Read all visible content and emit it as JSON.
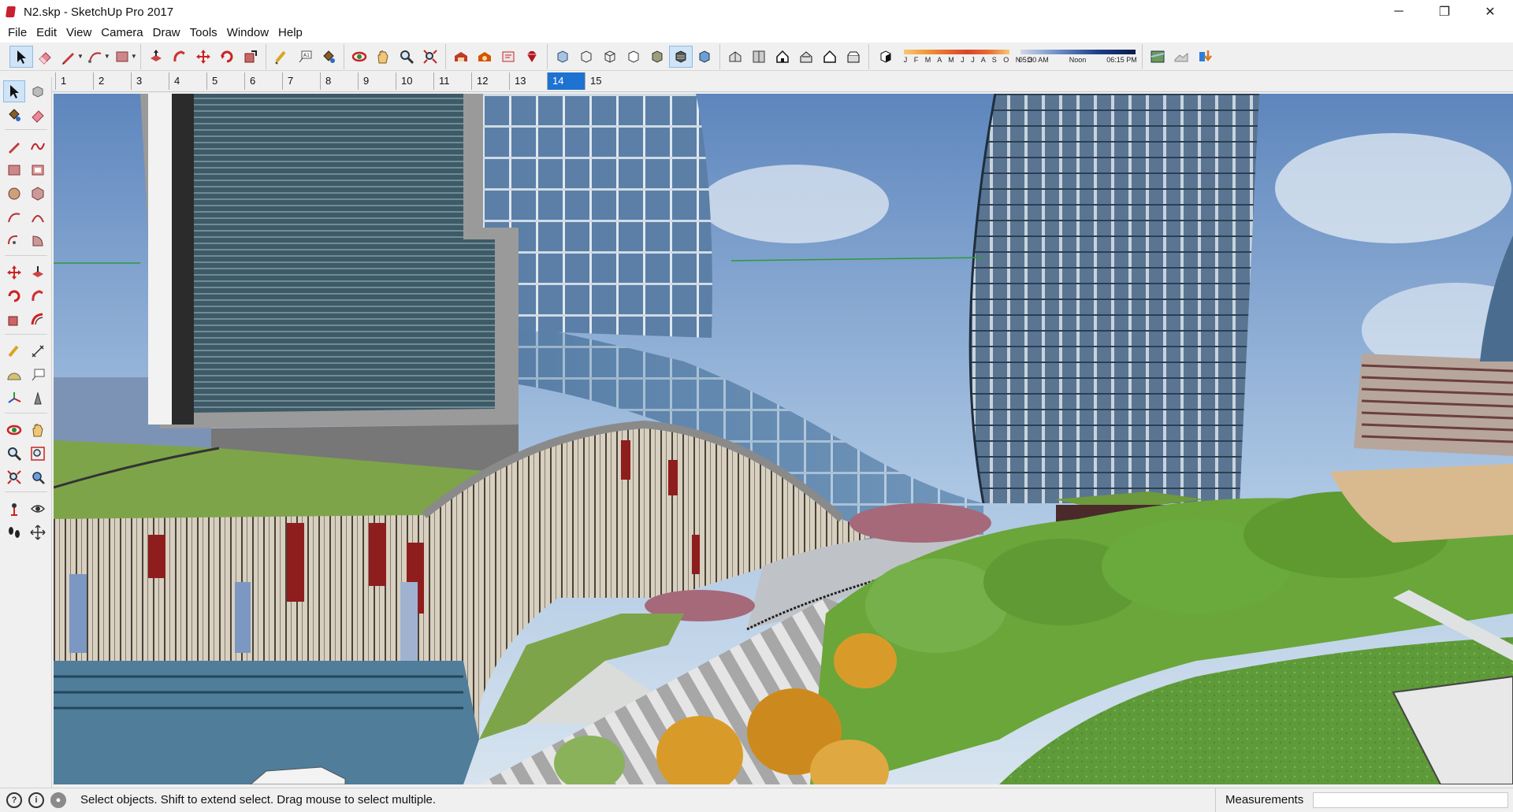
{
  "window": {
    "title": "N2.skp - SketchUp Pro 2017",
    "minimize": "─",
    "restore": "❐",
    "close": "✕"
  },
  "menu": [
    "File",
    "Edit",
    "View",
    "Camera",
    "Draw",
    "Tools",
    "Window",
    "Help"
  ],
  "toolbar": {
    "groups": [
      [
        "select-tool",
        "eraser-tool",
        "line-tool",
        "arc-tool",
        "shape-tool"
      ],
      [
        "push-pull-tool",
        "follow-me-tool",
        "move-tool",
        "rotate-tool",
        "scale-tool"
      ],
      [
        "tape-measure-tool",
        "text-tool",
        "paint-bucket-tool"
      ],
      [
        "orbit-tool",
        "pan-tool",
        "zoom-tool",
        "zoom-extents-tool"
      ],
      [
        "3d-warehouse",
        "extension-warehouse",
        "layout",
        "ruby-console"
      ],
      [
        "xray-style",
        "back-edges-style",
        "wireframe-style",
        "hidden-line-style",
        "shaded-style",
        "shaded-textures-style",
        "monochrome-style"
      ],
      [
        "iso-view",
        "top-view",
        "front-view",
        "right-view",
        "back-view",
        "left-view"
      ]
    ],
    "shadow": {
      "months": "J F M A M J J A S O N D",
      "time_start": "05:30 AM",
      "time_mid": "Noon",
      "time_end": "06:15 PM"
    }
  },
  "scene_tabs": [
    "1",
    "2",
    "3",
    "4",
    "5",
    "6",
    "7",
    "8",
    "9",
    "10",
    "11",
    "12",
    "13",
    "14",
    "15"
  ],
  "active_scene": "14",
  "status": {
    "message": "Select objects. Shift to extend select. Drag mouse to select multiple.",
    "measurements_label": "Measurements",
    "measurements_value": ""
  },
  "colors": {
    "accent": "#1e72d1",
    "sky": "#7fa8d6",
    "glass": "#5f86ab",
    "grass": "#7ea44a",
    "trees": "#6aa63a",
    "autumn_trees": "#d89b2a",
    "facade_red": "#8e1d1d"
  }
}
